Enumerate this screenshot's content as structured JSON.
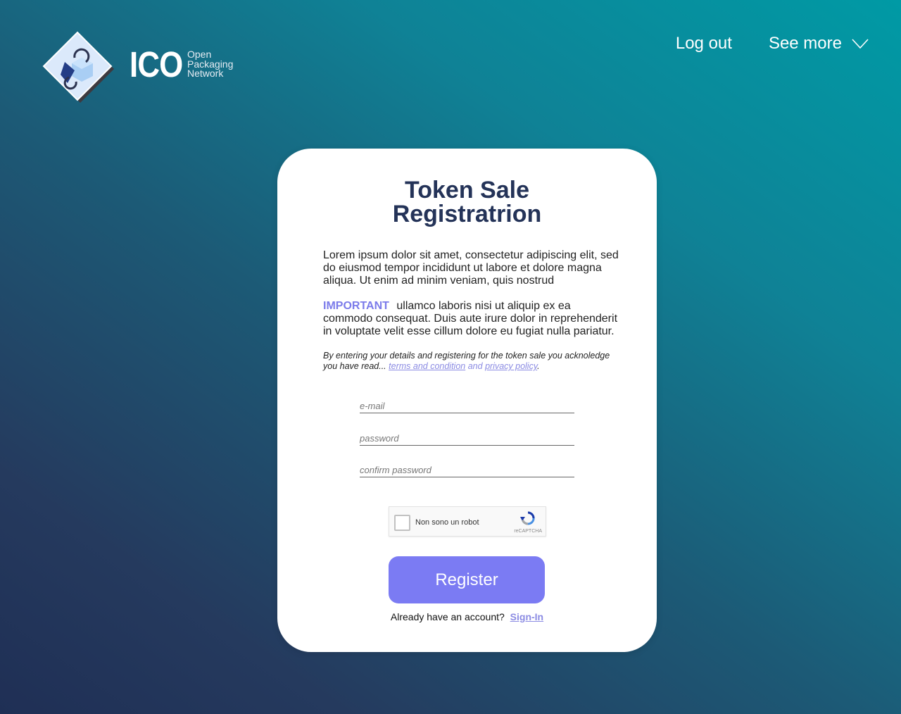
{
  "brand": {
    "wordmark": "ICO",
    "sub_line1": "Open",
    "sub_line2": "Packaging",
    "sub_line3": "Network"
  },
  "nav": {
    "logout": "Log out",
    "see_more": "See more"
  },
  "card": {
    "title_line1": "Token Sale",
    "title_line2": "Registratrion",
    "intro": "Lorem ipsum dolor sit amet, consectetur adipiscing elit, sed do eiusmod tempor incididunt ut labore et dolore magna aliqua. Ut enim ad minim veniam, quis nostrud",
    "important_label": "IMPORTANT",
    "important_text": "ullamco laboris nisi ut aliquip ex ea commodo consequat. Duis aute irure dolor in reprehenderit in voluptate velit esse cillum dolore eu fugiat nulla pariatur.",
    "note_text": "By entering your details and registering for the token sale you acknoledge you have read...",
    "terms_link": "terms and condition",
    "and_word": "and",
    "privacy_link": "privacy policy",
    "note_end": "."
  },
  "form": {
    "email_placeholder": "e-mail",
    "password_placeholder": "password",
    "confirm_placeholder": "confirm password",
    "captcha_label": "Non sono un robot",
    "captcha_brand": "reCAPTCHA",
    "register_label": "Register",
    "signin_prompt": "Already have an account?",
    "signin_link": "Sign-In"
  },
  "colors": {
    "accent": "#7b7bf3",
    "title": "#243358",
    "link": "#8b8be3"
  }
}
